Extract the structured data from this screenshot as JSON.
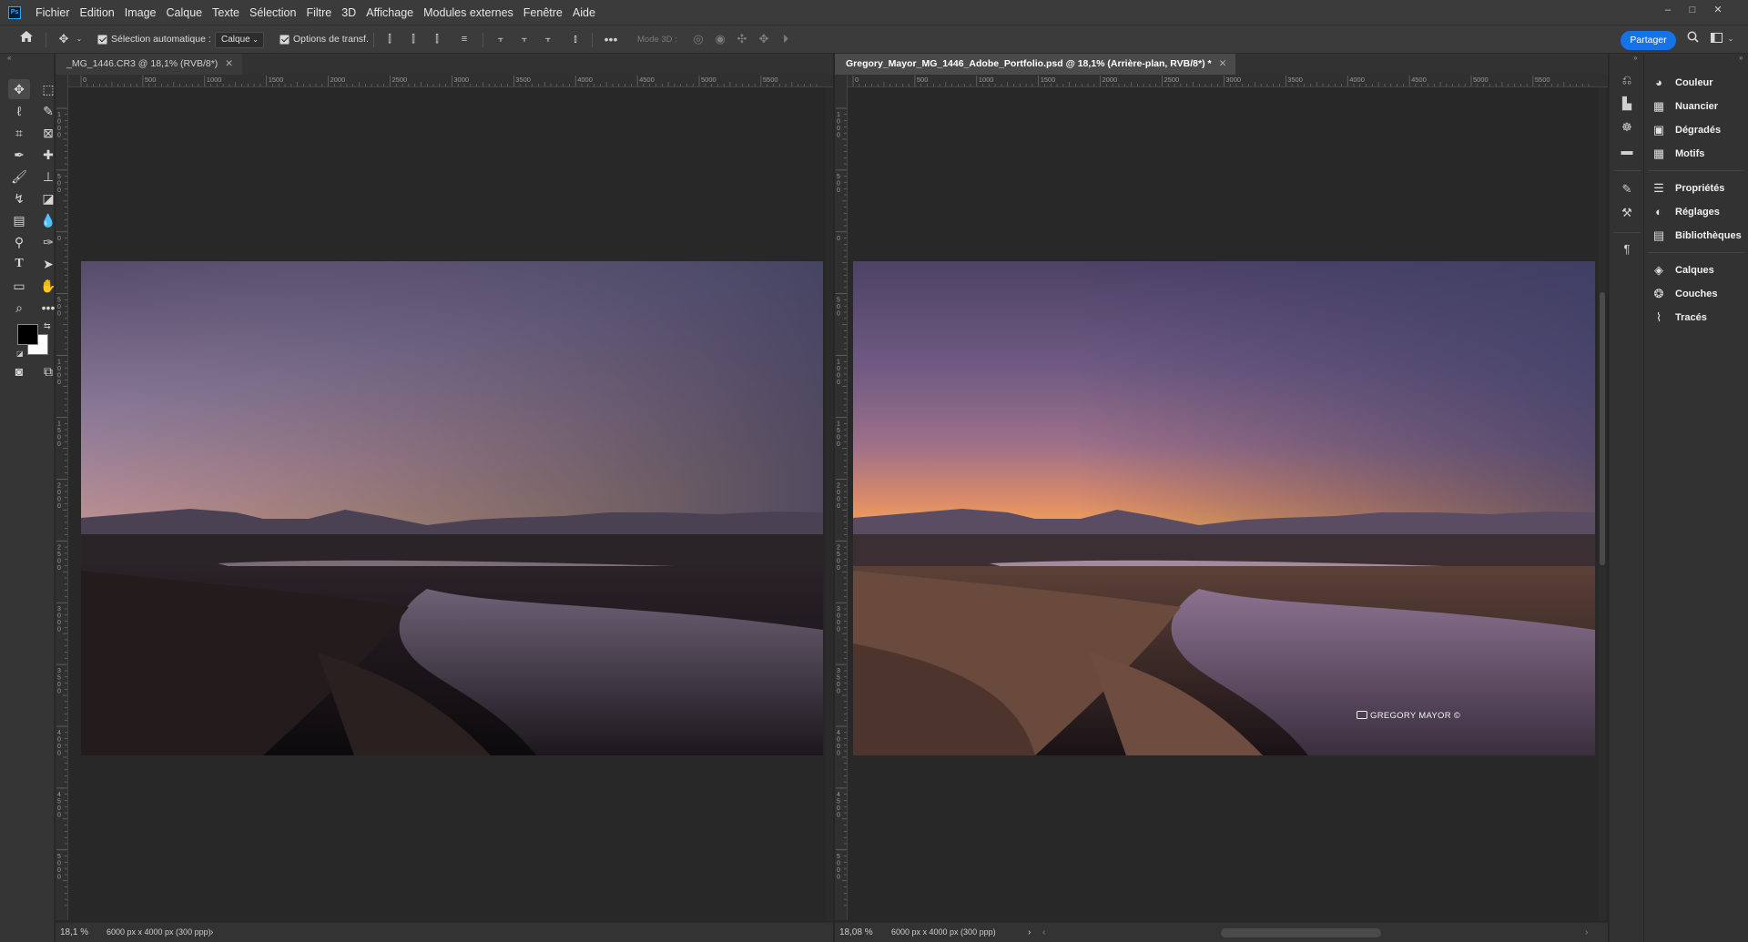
{
  "app": {
    "logo_text": "Ps"
  },
  "menu": {
    "items": [
      "Fichier",
      "Edition",
      "Image",
      "Calque",
      "Texte",
      "Sélection",
      "Filtre",
      "3D",
      "Affichage",
      "Modules externes",
      "Fenêtre",
      "Aide"
    ]
  },
  "window_controls": {
    "minimize": "–",
    "maximize": "□",
    "close": "✕"
  },
  "options": {
    "auto_select_label": "Sélection automatique :",
    "auto_select_checked": true,
    "layer_select_value": "Calque",
    "transform_label": "Options de transf.",
    "transform_checked": true,
    "mode3d_label": "Mode 3D :",
    "share_label": "Partager"
  },
  "documents": [
    {
      "tab_title": "_MG_1446.CR3 @ 18,1% (RVB/8*)",
      "zoom": "18,1 %",
      "doc_info": "6000 px x 4000 px (300 ppp)",
      "active": false,
      "ruler_h": [
        "0",
        "500",
        "1000",
        "1500",
        "2000",
        "2500",
        "3000",
        "3500",
        "4000",
        "4500",
        "5000",
        "5500"
      ],
      "ruler_v": [
        "1000",
        "500",
        "0",
        "500",
        "1000",
        "1500",
        "2000",
        "2500",
        "3000",
        "3500",
        "4000",
        "4500",
        "5000"
      ]
    },
    {
      "tab_title": "Gregory_Mayor_MG_1446_Adobe_Portfolio.psd @ 18,1% (Arrière-plan, RVB/8*) *",
      "zoom": "18,08 %",
      "doc_info": "6000 px x 4000 px (300 ppp)",
      "active": true,
      "watermark": "GREGORY MAYOR ©",
      "ruler_h": [
        "0",
        "500",
        "1000",
        "1500",
        "2000",
        "2500",
        "3000",
        "3500",
        "4000",
        "4500",
        "5000",
        "5500"
      ],
      "ruler_v": [
        "1000",
        "500",
        "0",
        "500",
        "1000",
        "1500",
        "2000",
        "2500",
        "3000",
        "3500",
        "4000",
        "4500",
        "5000"
      ]
    }
  ],
  "panels": {
    "group1": [
      "Couleur",
      "Nuancier",
      "Dégradés",
      "Motifs"
    ],
    "group2": [
      "Propriétés",
      "Réglages",
      "Bibliothèques"
    ],
    "group3": [
      "Calques",
      "Couches",
      "Tracés"
    ]
  },
  "colors": {
    "foreground": "#000000",
    "background": "#ffffff",
    "accent": "#1473e6"
  }
}
